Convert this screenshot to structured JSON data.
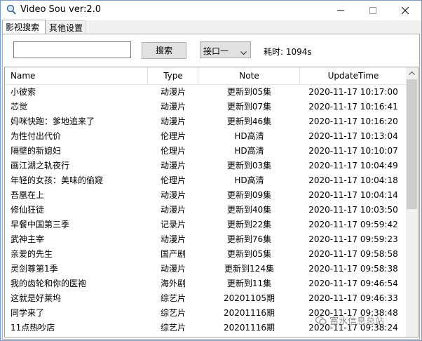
{
  "window": {
    "title": "Video Sou ver:2.0"
  },
  "tabs": [
    {
      "label": "影视搜索",
      "active": true
    },
    {
      "label": "其他设置",
      "active": false
    }
  ],
  "toolbar": {
    "search_value": "",
    "search_button": "搜索",
    "api_selected": "接口一",
    "elapsed_label": "耗时:",
    "elapsed_value": "1094s"
  },
  "table": {
    "columns": [
      "Name",
      "Type",
      "Note",
      "UpdateTime"
    ],
    "rows": [
      {
        "name": "小彼索",
        "type": "动漫片",
        "note": "更新到05集",
        "time": "2020-11-17 10:17:00"
      },
      {
        "name": "芯觉",
        "type": "动漫片",
        "note": "更新到07集",
        "time": "2020-11-17 10:16:41"
      },
      {
        "name": "妈咪快跑：爹地追来了",
        "type": "动漫片",
        "note": "更新到46集",
        "time": "2020-11-17 10:16:20"
      },
      {
        "name": "为性付出代价",
        "type": "伦理片",
        "note": "HD高清",
        "time": "2020-11-17 10:13:04"
      },
      {
        "name": "隔壁的新媳妇",
        "type": "伦理片",
        "note": "HD高清",
        "time": "2020-11-17 10:10:07"
      },
      {
        "name": "画江湖之轨夜行",
        "type": "动漫片",
        "note": "更新到03集",
        "time": "2020-11-17 10:04:49"
      },
      {
        "name": "年轻的女孩：美味的偷窥",
        "type": "伦理片",
        "note": "HD高清",
        "time": "2020-11-17 10:04:18"
      },
      {
        "name": "吾凰在上",
        "type": "动漫片",
        "note": "更新到09集",
        "time": "2020-11-17 10:04:14"
      },
      {
        "name": "修仙狂徒",
        "type": "动漫片",
        "note": "更新到40集",
        "time": "2020-11-17 10:03:50"
      },
      {
        "name": "早餐中国第三季",
        "type": "记录片",
        "note": "更新到22集",
        "time": "2020-11-17 09:59:42"
      },
      {
        "name": "武神主宰",
        "type": "动漫片",
        "note": "更新到76集",
        "time": "2020-11-17 09:59:23"
      },
      {
        "name": "亲爱的先生",
        "type": "国产剧",
        "note": "更新到05集",
        "time": "2020-11-17 09:58:58"
      },
      {
        "name": "灵剑尊第1季",
        "type": "动漫片",
        "note": "更新到124集",
        "time": "2020-11-17 09:58:38"
      },
      {
        "name": "我的齿轮和你的医袍",
        "type": "海外剧",
        "note": "更新到11集",
        "time": "2020-11-17 09:46:54"
      },
      {
        "name": "这就是好莱坞",
        "type": "综艺片",
        "note": "20201105期",
        "time": "2020-11-17 09:46:33"
      },
      {
        "name": "同学来了",
        "type": "综艺片",
        "note": "20201116期",
        "time": "2020-11-17 09:38:48"
      },
      {
        "name": "11点热吵店",
        "type": "综艺片",
        "note": "20201116期",
        "time": "2020-11-17 09:38:24"
      }
    ]
  },
  "watermark": {
    "text": "富水信息总站",
    "icon": "wechat-icon"
  },
  "colors": {
    "window_border": "#7a9cc6",
    "button_bg": "#e1e1e1",
    "scroll_thumb": "#cdcdcd"
  }
}
